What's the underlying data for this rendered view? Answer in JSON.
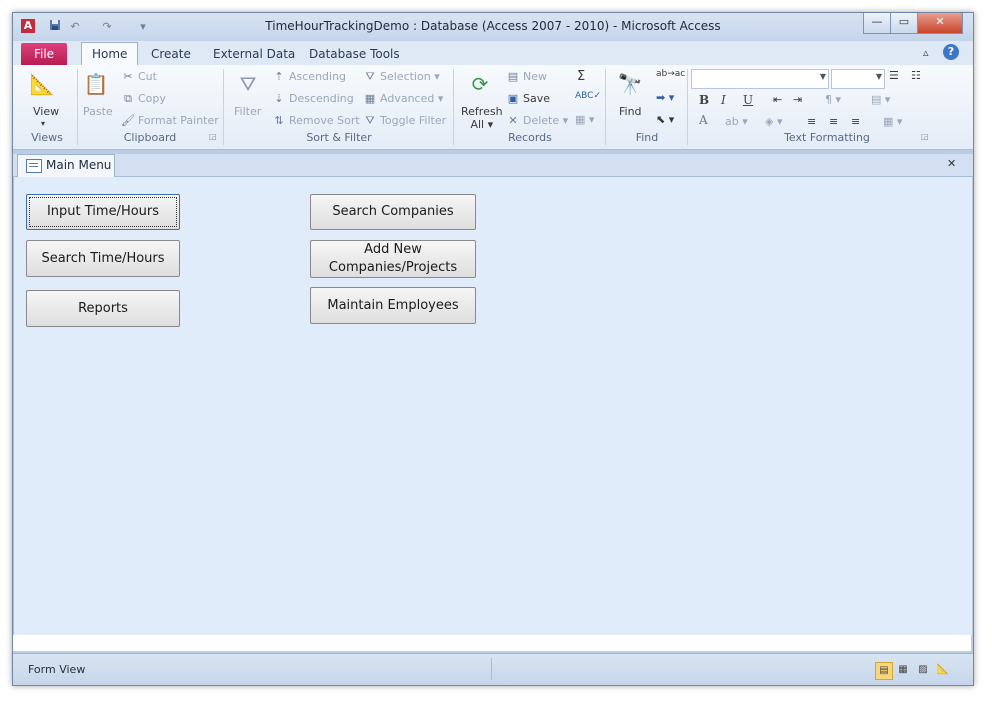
{
  "window": {
    "title": "TimeHourTrackingDemo : Database (Access 2007 - 2010)  -  Microsoft Access",
    "app_icon": "A",
    "controls": {
      "minimize": "—",
      "maximize": "▭",
      "close": "✕"
    }
  },
  "qat": {
    "save": "save-icon",
    "undo": "↶",
    "redo": "↷",
    "customize": "▾"
  },
  "tabs": [
    {
      "label": "File"
    },
    {
      "label": "Home"
    },
    {
      "label": "Create"
    },
    {
      "label": "External Data"
    },
    {
      "label": "Database Tools"
    }
  ],
  "ribbon": {
    "views": {
      "view_label": "View",
      "group": "Views"
    },
    "clipboard": {
      "paste": "Paste",
      "cut": "Cut",
      "copy": "Copy",
      "format_painter": "Format Painter",
      "group": "Clipboard"
    },
    "sort_filter": {
      "filter": "Filter",
      "ascending": "Ascending",
      "descending": "Descending",
      "remove_sort": "Remove Sort",
      "selection": "Selection",
      "advanced": "Advanced",
      "toggle_filter": "Toggle Filter",
      "group": "Sort & Filter"
    },
    "records": {
      "refresh_line1": "Refresh",
      "refresh_line2": "All",
      "new": "New",
      "save": "Save",
      "delete": "Delete",
      "group": "Records"
    },
    "find": {
      "find": "Find",
      "group": "Find"
    },
    "text_formatting": {
      "group": "Text Formatting",
      "bold": "B",
      "italic": "I",
      "underline": "U",
      "font_color": "A"
    }
  },
  "document": {
    "tab_label": "Main Menu",
    "close": "✕"
  },
  "form": {
    "buttons": [
      {
        "label": "Input Time/Hours"
      },
      {
        "label": "Search Time/Hours"
      },
      {
        "label": "Reports"
      },
      {
        "label": "Search Companies"
      },
      {
        "label": "Add New Companies/Projects"
      },
      {
        "label": "Maintain Employees"
      }
    ]
  },
  "status": {
    "view": "Form View"
  },
  "colors": {
    "file_tab": "#c42b62",
    "form_bg": "#e1ecfa",
    "ribbon_bg": "#f7fafd"
  }
}
